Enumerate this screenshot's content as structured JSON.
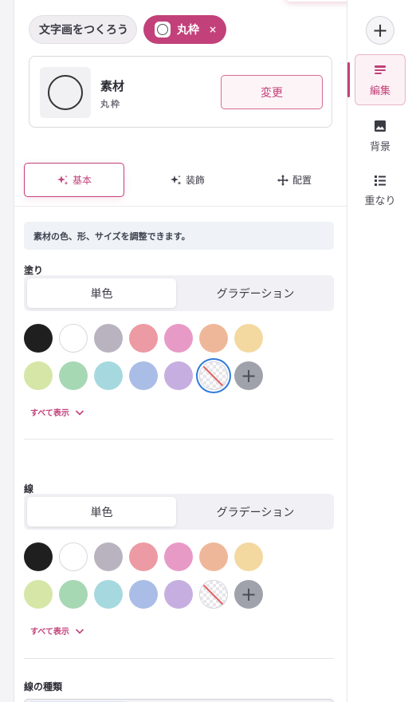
{
  "breadcrumb": {
    "parent": "文字画をつくろう",
    "current": "丸枠",
    "close": "×"
  },
  "material": {
    "title": "素材",
    "name": "丸枠",
    "change_label": "変更"
  },
  "subtabs": [
    {
      "label": "基本",
      "icon": "sparkle-icon",
      "active": true
    },
    {
      "label": "装飾",
      "icon": "sparkle-icon",
      "active": false
    },
    {
      "label": "配置",
      "icon": "move-icon",
      "active": false
    }
  ],
  "info_text": "素材の色、形、サイズを調整できます。",
  "fill": {
    "label": "塗り",
    "modes": [
      "単色",
      "グラデーション"
    ],
    "selected_mode": "単色",
    "selected_color": "transparent",
    "show_all": "すべて表示"
  },
  "stroke": {
    "label": "線",
    "modes": [
      "単色",
      "グラデーション"
    ],
    "selected_mode": "単色",
    "show_all": "すべて表示"
  },
  "stroke_type": {
    "label": "線の種類"
  },
  "palette": [
    "#1f1f1f",
    "#ffffff",
    "#b9b3bf",
    "#ec9aa3",
    "#e89ac6",
    "#efb79a",
    "#f3d9a0",
    "#d6e6a6",
    "#a7d8b4",
    "#a6d9df",
    "#a9bde6",
    "#c6afe0",
    "transparent",
    "add"
  ],
  "rail": {
    "add": "+",
    "items": [
      {
        "label": "編集",
        "icon": "edit-icon",
        "active": true
      },
      {
        "label": "背景",
        "icon": "image-icon",
        "active": false
      },
      {
        "label": "重なり",
        "icon": "layers-icon",
        "active": false
      }
    ]
  },
  "colors": {
    "accent": "#c2417a",
    "selected_outline": "#2f7bd8"
  }
}
